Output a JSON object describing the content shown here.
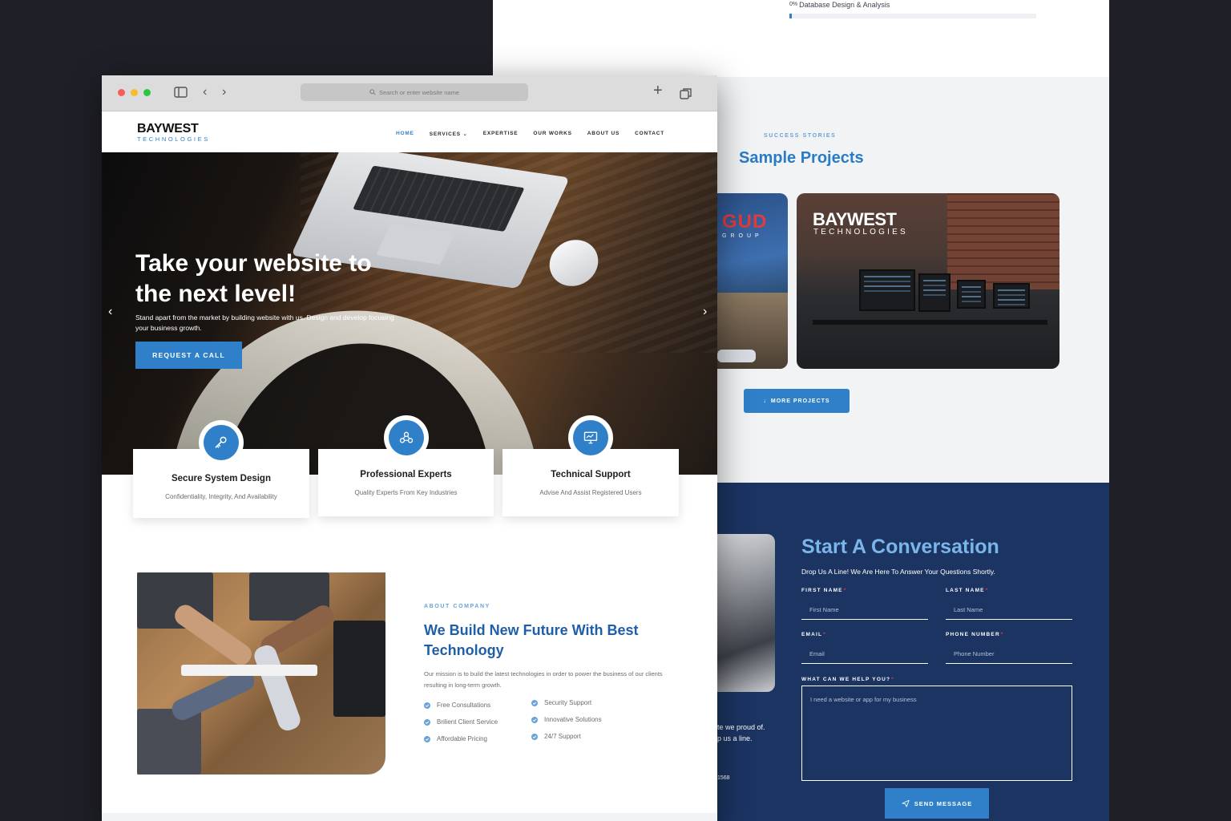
{
  "back_page": {
    "progress": {
      "label": "Database Design & Analysis",
      "percent_text": "0%",
      "value": 0.01
    },
    "projects": {
      "eyebrow": "SUCCESS STORIES",
      "title": "Sample Projects",
      "cards": [
        {
          "logo": "GUD",
          "logo_sub": "GROUP"
        },
        {
          "logo": "BAYWEST",
          "logo_sub": "TECHNOLOGIES"
        }
      ],
      "more_button": "MORE PROJECTS"
    },
    "contact": {
      "fragment_lines": [
        "te we proud of.",
        "p us a line.",
        "1568"
      ],
      "title": "Start A Conversation",
      "description": "Drop Us A Line! We Are Here To Answer Your Questions Shortly.",
      "required_mark": "*",
      "first_name": {
        "label": "FIRST NAME",
        "placeholder": "First Name"
      },
      "last_name": {
        "label": "LAST NAME",
        "placeholder": "Last Name"
      },
      "email": {
        "label": "EMAIL",
        "placeholder": "Email"
      },
      "phone": {
        "label": "PHONE NUMBER",
        "placeholder": "Phone Number"
      },
      "message": {
        "label": "WHAT CAN WE HELP YOU?",
        "placeholder": "I need a website or app for my business"
      },
      "send_button": "SEND MESSAGE"
    }
  },
  "browser": {
    "address_placeholder": "Search or enter website name",
    "brand": {
      "name": "BAYWEST",
      "sub": "TECHNOLOGIES"
    },
    "nav": [
      "HOME",
      "SERVICES",
      "EXPERTISE",
      "OUR WORKS",
      "ABOUT US",
      "CONTACT"
    ],
    "hero": {
      "title": "Take your website to the next level!",
      "subtitle": "Stand apart from the market by building website with us. Design and develop focusing your business growth.",
      "button": "REQUEST A CALL"
    },
    "features": [
      {
        "title": "Secure System Design",
        "subtitle": "Confidentiality, Integrity, And Availability",
        "icon": "key-icon"
      },
      {
        "title": "Professional Experts",
        "subtitle": "Quality Experts From Key Industries",
        "icon": "network-icon"
      },
      {
        "title": "Technical Support",
        "subtitle": "Advise And Assist Registered Users",
        "icon": "monitor-icon"
      }
    ],
    "about": {
      "eyebrow": "ABOUT COMPANY",
      "title": "We Build New Future With Best Technology",
      "text": "Our mission is to build the latest technologies in order to power the business of our clients resulting in long-term growth.",
      "list_left": [
        "Free Consultations",
        "Brilient Client Service",
        "Affordable Pricing"
      ],
      "list_right": [
        "Security Support",
        "Innovative Solutions",
        "24/7 Support"
      ]
    }
  },
  "colors": {
    "accent": "#2f80c9",
    "navy": "#1b3462",
    "background": "#1f1f27",
    "eyebrow": "#6aa2d8",
    "heading_blue": "#1f5ea8"
  }
}
